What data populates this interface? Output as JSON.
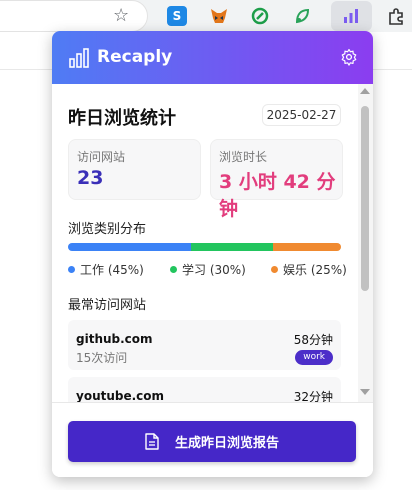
{
  "browser": {
    "extensions": [
      "s-extension-icon",
      "metamask-fox-icon",
      "green-circle-extension-icon",
      "green-sprout-extension-icon",
      "recaply-chart-icon",
      "puzzle-icon"
    ]
  },
  "header": {
    "brand": "Recaply"
  },
  "main": {
    "title": "昨日浏览统计",
    "date": "2025-02-27",
    "stats": {
      "sites_label": "访问网站",
      "sites_value": "23",
      "duration_label": "浏览时长",
      "duration_value": "3 小时 42 分钟"
    },
    "category_title": "浏览类别分布",
    "categories": [
      {
        "label": "工作 (45%)",
        "percent": 45,
        "color": "#3b82f6"
      },
      {
        "label": "学习 (30%)",
        "percent": 30,
        "color": "#22c55e"
      },
      {
        "label": "娱乐 (25%)",
        "percent": 25,
        "color": "#f08a30"
      }
    ],
    "top_sites_title": "最常访问网站",
    "sites": [
      {
        "name": "github.com",
        "visits": "15次访问",
        "time": "58分钟",
        "badge": "work"
      },
      {
        "name": "youtube.com",
        "visits": "",
        "time": "32分钟",
        "badge": ""
      }
    ]
  },
  "footer": {
    "generate_label": "生成昨日浏览报告"
  },
  "colors": {
    "header_start": "#4f7cf4",
    "header_end": "#8b3df0",
    "sites_value": "#3a2fb8",
    "duration_value": "#e23d7d",
    "button": "#4527c8"
  }
}
